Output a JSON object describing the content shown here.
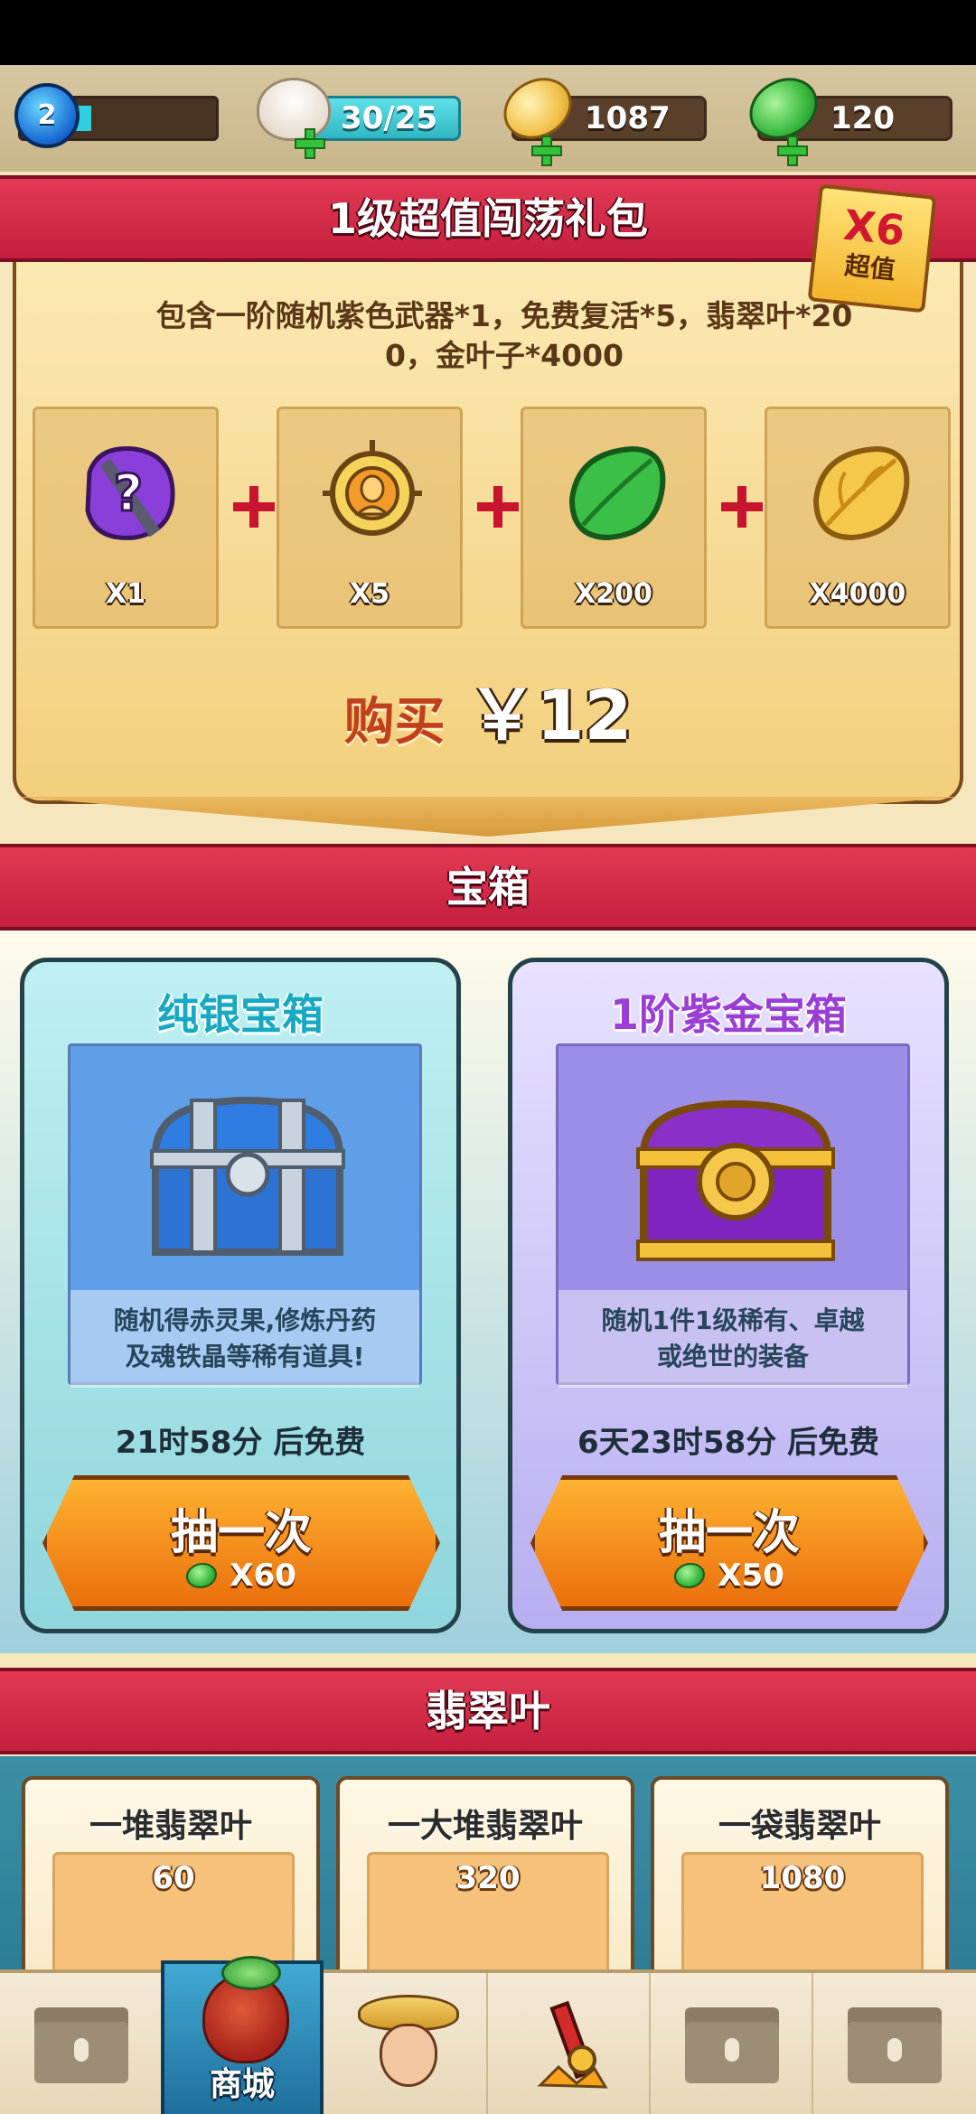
{
  "topbar": {
    "level": "2",
    "stamina": "30/25",
    "gold_leaves": "1087",
    "emerald_leaves": "120"
  },
  "gift_pack": {
    "title": "1级超值闯荡礼包",
    "badge_multiplier": "X6",
    "badge_text": "超值",
    "description_line1": "包含一阶随机紫色武器*1，免费复活*5，翡翠叶*20",
    "description_line2": "0，金叶子*4000",
    "items": [
      {
        "icon": "mystery-weapon-icon",
        "qty": "X1"
      },
      {
        "icon": "revive-icon",
        "qty": "X5"
      },
      {
        "icon": "emerald-leaf-icon",
        "qty": "X200"
      },
      {
        "icon": "gold-leaf-icon",
        "qty": "X4000"
      }
    ],
    "buy_label": "购买",
    "price": "￥12"
  },
  "chest_section": {
    "title": "宝箱",
    "chests": [
      {
        "name": "纯银宝箱",
        "desc_line1": "随机得赤灵果,修炼丹药",
        "desc_line2": "及魂铁晶等稀有道具!",
        "timer": "21时58分 后免费",
        "button_label": "抽一次",
        "cost": "X60"
      },
      {
        "name": "1阶紫金宝箱",
        "desc_line1": "随机1件1级稀有、卓越",
        "desc_line2": "或绝世的装备",
        "timer": "6天23时58分 后免费",
        "button_label": "抽一次",
        "cost": "X50"
      }
    ]
  },
  "emerald_section": {
    "title": "翡翠叶",
    "cards": [
      {
        "name": "一堆翡翠叶",
        "amount": "60"
      },
      {
        "name": "一大堆翡翠叶",
        "amount": "320"
      },
      {
        "name": "一袋翡翠叶",
        "amount": "1080"
      }
    ]
  },
  "tabbar": {
    "active_label": "商城"
  },
  "colors": {
    "ribbon_red": "#d22a47",
    "panel_gold": "#f2cf7c",
    "button_orange": "#f08a18",
    "tab_active_blue": "#2a86b8"
  }
}
